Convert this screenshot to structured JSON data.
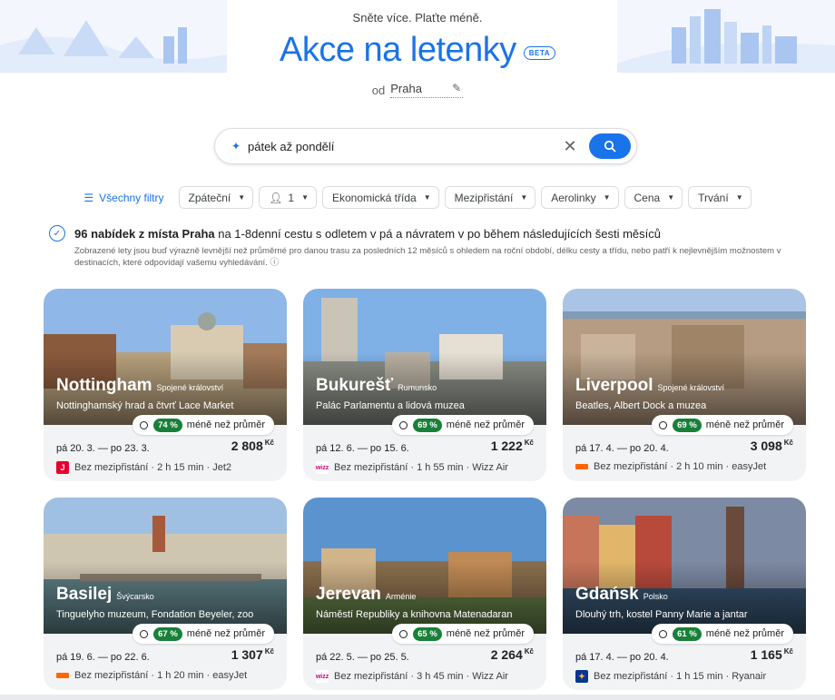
{
  "header": {
    "tagline": "Sněte více. Plaťte méně.",
    "title": "Akce na letenky",
    "badge": "BETA",
    "origin_prefix": "od",
    "origin_city": "Praha"
  },
  "search": {
    "query": "pátek až pondělí",
    "clear_icon": "close-icon",
    "search_icon": "search-icon"
  },
  "filters": {
    "all_filters": "Všechny filtry",
    "chips": [
      {
        "label": "Zpáteční"
      },
      {
        "label": "1"
      },
      {
        "label": "Ekonomická třída"
      },
      {
        "label": "Mezipřistání"
      },
      {
        "label": "Aerolinky"
      },
      {
        "label": "Cena"
      },
      {
        "label": "Trvání"
      }
    ]
  },
  "info": {
    "count_text": "96 nabídek z místa Praha",
    "rest_text": " na 1-8denní cestu s odletem v pá a návratem v po během následujících šesti měsíců",
    "sub": "Zobrazené lety jsou buď výrazně levnější než průměrné pro danou trasu za posledních 12 měsíců s ohledem na roční období, délku cesty a třídu, nebo patří k nejlevnějším možnostem v destinacích, které odpovídají vašemu vyhledávání. ⓘ"
  },
  "cards": [
    {
      "city": "Nottingham",
      "country": "Spojené království",
      "sights": "Nottinghamský hrad a čtvrť Lace Market",
      "pct": "74 %",
      "below": "méně než průměr",
      "dates": "pá 20. 3. — po 23. 3.",
      "price": "2 808",
      "currency": "Kč",
      "flight": "Bez mezipřistání · 2 h 15 min · Jet2",
      "airline_logo": "jet2",
      "logo_char": "J"
    },
    {
      "city": "Bukurešť",
      "country": "Rumunsko",
      "sights": "Palác Parlamentu a lidová muzea",
      "pct": "69 %",
      "below": "méně než průměr",
      "dates": "pá 12. 6. — po 15. 6.",
      "price": "1 222",
      "currency": "Kč",
      "flight": "Bez mezipřistání · 1 h 55 min · Wizz Air",
      "airline_logo": "wizz",
      "logo_char": "wizz"
    },
    {
      "city": "Liverpool",
      "country": "Spojené království",
      "sights": "Beatles, Albert Dock a muzea",
      "pct": "69 %",
      "below": "méně než průměr",
      "dates": "pá 17. 4. — po 20. 4.",
      "price": "3 098",
      "currency": "Kč",
      "flight": "Bez mezipřistání · 2 h 10 min · easyJet",
      "airline_logo": "easy",
      "logo_char": ""
    },
    {
      "city": "Basilej",
      "country": "Švýcarsko",
      "sights": "Tinguelyho muzeum, Fondation Beyeler, zoo",
      "pct": "67 %",
      "below": "méně než průměr",
      "dates": "pá 19. 6. — po 22. 6.",
      "price": "1 307",
      "currency": "Kč",
      "flight": "Bez mezipřistání · 1 h 20 min · easyJet",
      "airline_logo": "easy",
      "logo_char": ""
    },
    {
      "city": "Jerevan",
      "country": "Arménie",
      "sights": "Náměstí Republiky a knihovna Matenadaran",
      "pct": "65 %",
      "below": "méně než průměr",
      "dates": "pá 22. 5. — po 25. 5.",
      "price": "2 264",
      "currency": "Kč",
      "flight": "Bez mezipřistání · 3 h 45 min · Wizz Air",
      "airline_logo": "wizz",
      "logo_char": "wizz"
    },
    {
      "city": "Gdańsk",
      "country": "Polsko",
      "sights": "Dlouhý trh, kostel Panny Marie a jantar",
      "pct": "61 %",
      "below": "méně než průměr",
      "dates": "pá 17. 4. — po 20. 4.",
      "price": "1 165",
      "currency": "Kč",
      "flight": "Bez mezipřistání · 1 h 15 min · Ryanair",
      "airline_logo": "ryan",
      "logo_char": "✦"
    }
  ],
  "colors": {
    "accent": "#1a73e8",
    "deal_green": "#188038"
  }
}
